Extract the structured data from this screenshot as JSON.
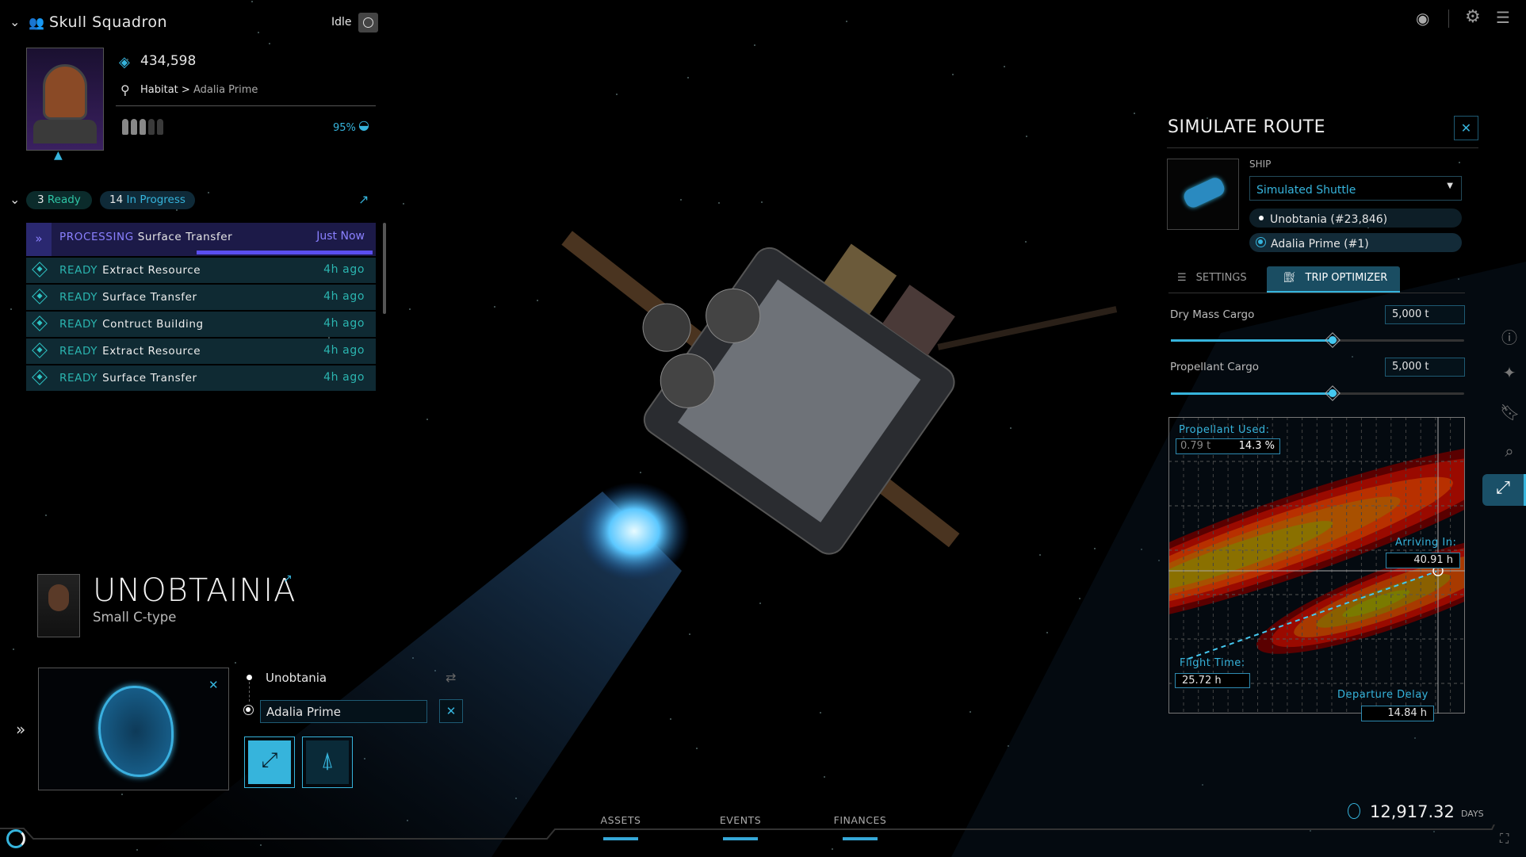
{
  "crew": {
    "name": "Skull Squadron",
    "status": "Idle",
    "balance": "434,598",
    "location": "Habitat",
    "location_sep": ">",
    "location_detail": "Adalia Prime",
    "food": "95%",
    "crew_slots_filled": 3,
    "crew_slots_total": 5
  },
  "actions": {
    "ready_count": "3",
    "ready_label": "Ready",
    "progress_count": "14",
    "progress_label": "In Progress",
    "items": [
      {
        "status": "PROCESSING",
        "name": "Surface Transfer",
        "time": "Just Now",
        "progress": 0.52
      },
      {
        "status": "READY",
        "name": "Extract Resource",
        "time": "4h ago"
      },
      {
        "status": "READY",
        "name": "Surface Transfer",
        "time": "4h ago"
      },
      {
        "status": "READY",
        "name": "Contruct Building",
        "time": "4h ago"
      },
      {
        "status": "READY",
        "name": "Extract Resource",
        "time": "4h ago"
      },
      {
        "status": "READY",
        "name": "Surface Transfer",
        "time": "4h ago"
      }
    ]
  },
  "asteroid": {
    "name": "UNOBTAINIA",
    "type": "Small C-type",
    "origin": "Unobtania",
    "destination": "Adalia Prime"
  },
  "bottom": {
    "tabs": [
      "ASSETS",
      "EVENTS",
      "FINANCES"
    ],
    "days_value": "12,917.32",
    "days_unit": "DAYS"
  },
  "simulate": {
    "title": "SIMULATE ROUTE",
    "ship_label": "SHIP",
    "ship_selected": "Simulated Shuttle",
    "origin": "Unobtania (#23,846)",
    "destination": "Adalia Prime (#1)",
    "tabs": [
      "SETTINGS",
      "TRIP OPTIMIZER"
    ],
    "active_tab": "TRIP OPTIMIZER",
    "dry_mass_label": "Dry Mass Cargo",
    "dry_mass_value": "5,000 t",
    "dry_mass_fraction": 0.55,
    "propellant_label": "Propellant Cargo",
    "propellant_value": "5,000 t",
    "propellant_fraction": 0.55,
    "propellant_used_label": "Propellant Used:",
    "propellant_used_mass": "0.79 t",
    "propellant_used_pct": "14.3 %",
    "arriving_label": "Arriving In:",
    "arriving_value": "40.91 h",
    "flight_label": "Flight Time:",
    "flight_value": "25.72 h",
    "departure_label": "Departure Delay",
    "departure_value": "14.84 h"
  },
  "colors": {
    "accent": "#36b4dc",
    "ready": "#2bb5b0",
    "processing": "#7b6cf0",
    "heat_low": "#8b0000",
    "heat_high": "#b8a800"
  }
}
